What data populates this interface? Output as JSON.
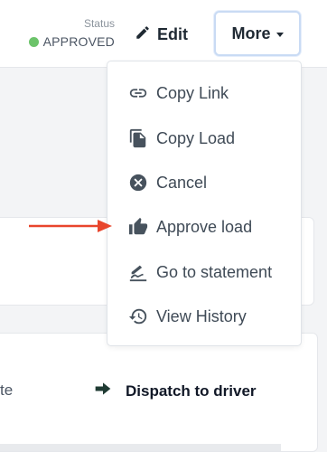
{
  "header": {
    "status_label": "Status",
    "status_value": "APPROVED",
    "status_color": "#6cc36a",
    "edit_label": "Edit",
    "more_label": "More"
  },
  "dropdown": {
    "items": [
      {
        "label": "Copy Link",
        "icon": "link-icon"
      },
      {
        "label": "Copy Load",
        "icon": "copy-icon"
      },
      {
        "label": "Cancel",
        "icon": "cancel-circle-icon"
      },
      {
        "label": "Approve load",
        "icon": "thumbs-up-icon"
      },
      {
        "label": "Go to statement",
        "icon": "signature-icon"
      },
      {
        "label": "View History",
        "icon": "history-icon"
      }
    ]
  },
  "background": {
    "partial_text": "te",
    "dispatch_label": "Dispatch to driver"
  },
  "annotation": {
    "arrow_color": "#e8452c"
  }
}
